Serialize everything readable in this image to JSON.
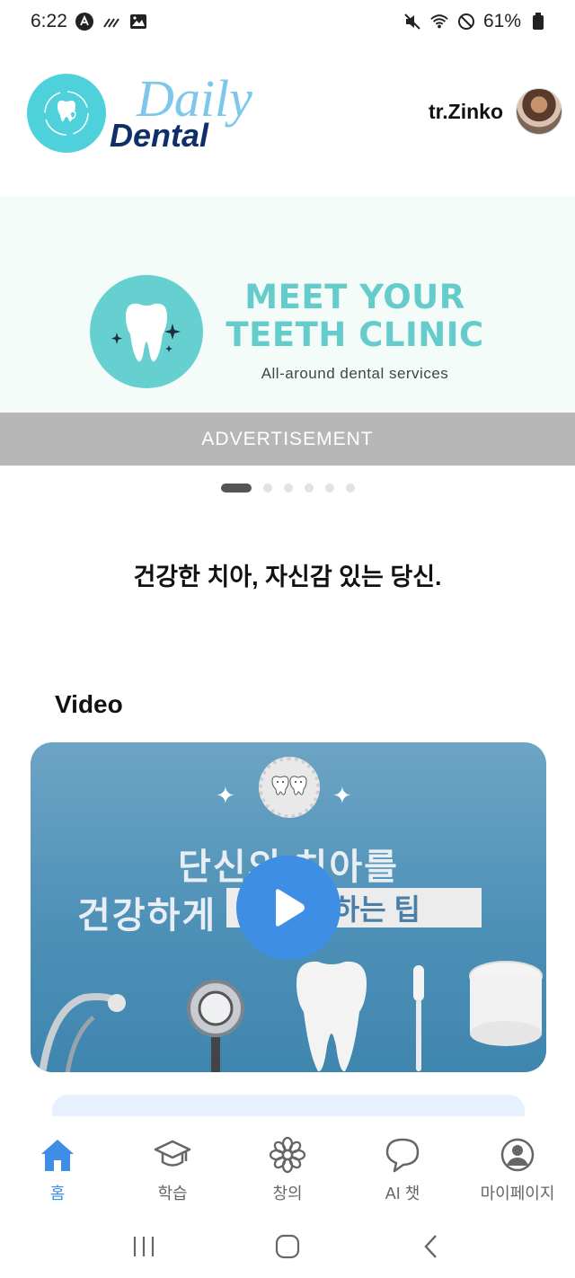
{
  "status_bar": {
    "time": "6:22",
    "battery": "61%"
  },
  "header": {
    "logo_word_1": "Daily",
    "logo_word_2": "Dental",
    "username": "tr.Zinko"
  },
  "banner": {
    "title": "MEET YOUR TEETH CLINIC",
    "subtitle": "All-around dental services",
    "label": "ADVERTISEMENT",
    "pages": 6,
    "active_page": 1
  },
  "slogan": "건강한 치아, 자신감 있는 당신.",
  "video_section": {
    "title": "Video",
    "thumbnail_line1": "단신의 치아를",
    "thumbnail_line2": "건강하게",
    "thumbnail_box": "하는 팁"
  },
  "bottom_nav": {
    "items": [
      {
        "label": "홈",
        "icon": "home-icon",
        "active": true
      },
      {
        "label": "학습",
        "icon": "graduation-cap-icon",
        "active": false
      },
      {
        "label": "창의",
        "icon": "flower-icon",
        "active": false
      },
      {
        "label": "AI 챗",
        "icon": "chat-bubble-icon",
        "active": false
      },
      {
        "label": "마이페이지",
        "icon": "user-circle-icon",
        "active": false
      }
    ]
  },
  "colors": {
    "accent": "#3d8ee4",
    "banner_teal": "#66cccb",
    "logo_navy": "#0f2f6b"
  }
}
